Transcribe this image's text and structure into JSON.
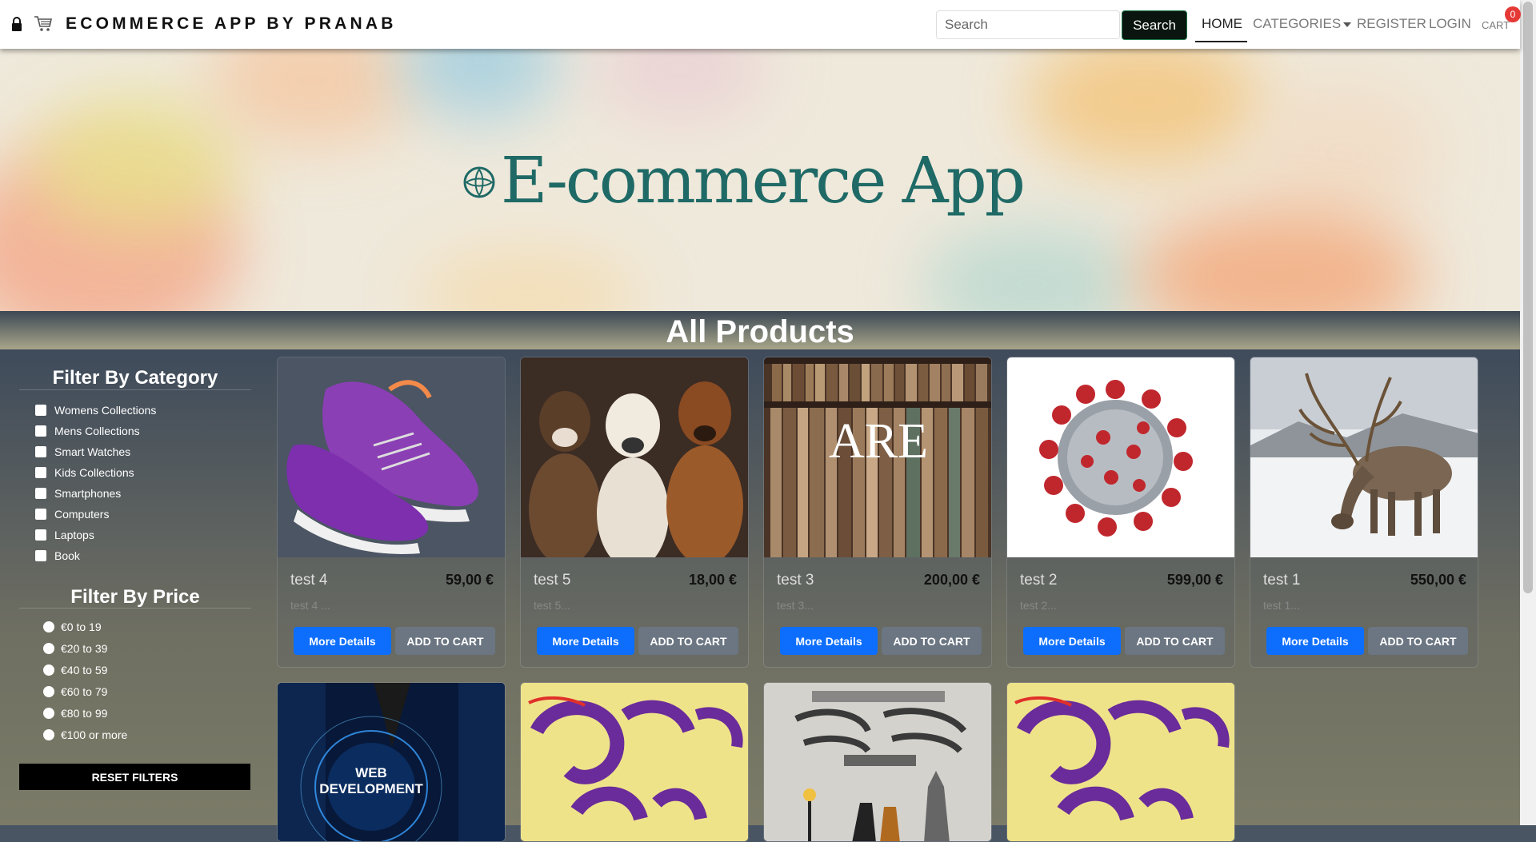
{
  "navbar": {
    "brand": "ECOMMERCE APP BY PRANAB",
    "search_placeholder": "Search",
    "search_button": "Search",
    "links": {
      "home": "HOME",
      "categories": "CATEGORIES",
      "register": "REGISTER",
      "login": "LOGIN",
      "cart": "CART"
    },
    "cart_count": "0"
  },
  "hero": {
    "title": "E-commerce App"
  },
  "section_title": "All Products",
  "sidebar": {
    "category_title": "Filter By Category",
    "categories": [
      "Womens Collections",
      "Mens Collections",
      "Smart Watches",
      "Kids Collections",
      "Smartphones",
      "Computers",
      "Laptops",
      "Book"
    ],
    "price_title": "Filter By Price",
    "prices": [
      "€0 to 19",
      "€20 to 39",
      "€40 to 59",
      "€60 to 79",
      "€80 to 99",
      "€100 or more"
    ],
    "reset_label": "RESET FILTERS"
  },
  "products": [
    {
      "name": "test 4",
      "price": "59,00 €",
      "desc": "test 4 ...",
      "image": "purple-sneakers"
    },
    {
      "name": "test 5",
      "price": "18,00 €",
      "desc": "test 5...",
      "image": "three-dogs"
    },
    {
      "name": "test 3",
      "price": "200,00 €",
      "desc": "test 3...",
      "image": "bookshelf",
      "image_text": "ARE"
    },
    {
      "name": "test 2",
      "price": "599,00 €",
      "desc": "test 2...",
      "image": "virus"
    },
    {
      "name": "test 1",
      "price": "550,00 €",
      "desc": "test 1...",
      "image": "reindeer"
    }
  ],
  "product_buttons": {
    "more": "More Details",
    "add": "ADD TO CART"
  },
  "products_row2": [
    {
      "image": "web-development",
      "image_text": "WEB DEVELOPMENT"
    },
    {
      "image": "bengali-book-cover"
    },
    {
      "image": "bengali-book-vintage"
    },
    {
      "image": "bengali-book-cover"
    }
  ],
  "colors": {
    "primary_button": "#0d6efd",
    "badge": "#e53935",
    "hero_text": "#1f6a66"
  }
}
